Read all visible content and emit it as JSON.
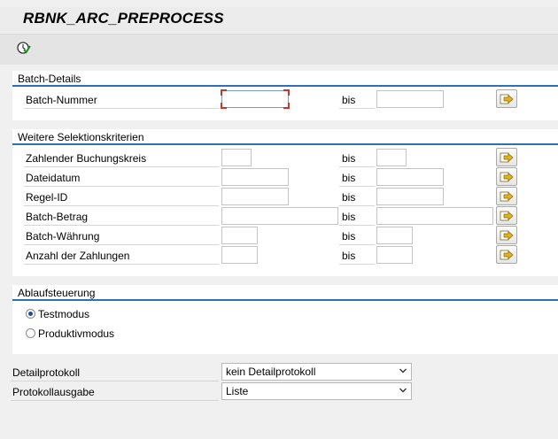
{
  "window": {
    "title": "RBNK_ARC_PREPROCESS"
  },
  "toolbar": {
    "execute_icon": "execute-clock-check-icon"
  },
  "batch_details": {
    "title": "Batch-Details",
    "rows": [
      {
        "label": "Batch-Nummer",
        "from_value": "",
        "to_label": "bis",
        "to_value": ""
      }
    ]
  },
  "further_criteria": {
    "title": "Weitere Selektionskriterien",
    "rows": [
      {
        "label": "Zahlender Buchungskreis",
        "from_value": "",
        "to_label": "bis",
        "to_value": ""
      },
      {
        "label": "Dateidatum",
        "from_value": "",
        "to_label": "bis",
        "to_value": ""
      },
      {
        "label": "Regel-ID",
        "from_value": "",
        "to_label": "bis",
        "to_value": ""
      },
      {
        "label": "Batch-Betrag",
        "from_value": "",
        "to_label": "bis",
        "to_value": ""
      },
      {
        "label": "Batch-Währung",
        "from_value": "",
        "to_label": "bis",
        "to_value": ""
      },
      {
        "label": "Anzahl der Zahlungen",
        "from_value": "",
        "to_label": "bis",
        "to_value": ""
      }
    ]
  },
  "flow_control": {
    "title": "Ablaufsteuerung",
    "options": [
      {
        "label": "Testmodus",
        "selected": true
      },
      {
        "label": "Produktivmodus",
        "selected": false
      }
    ]
  },
  "settings": {
    "detail_log": {
      "label": "Detailprotokoll",
      "value": "kein Detailprotokoll"
    },
    "log_output": {
      "label": "Protokollausgabe",
      "value": "Liste"
    }
  },
  "colors": {
    "accent": "#2e6fb6",
    "focus_corner": "#c0392b",
    "arrow": "#e3b21a"
  }
}
